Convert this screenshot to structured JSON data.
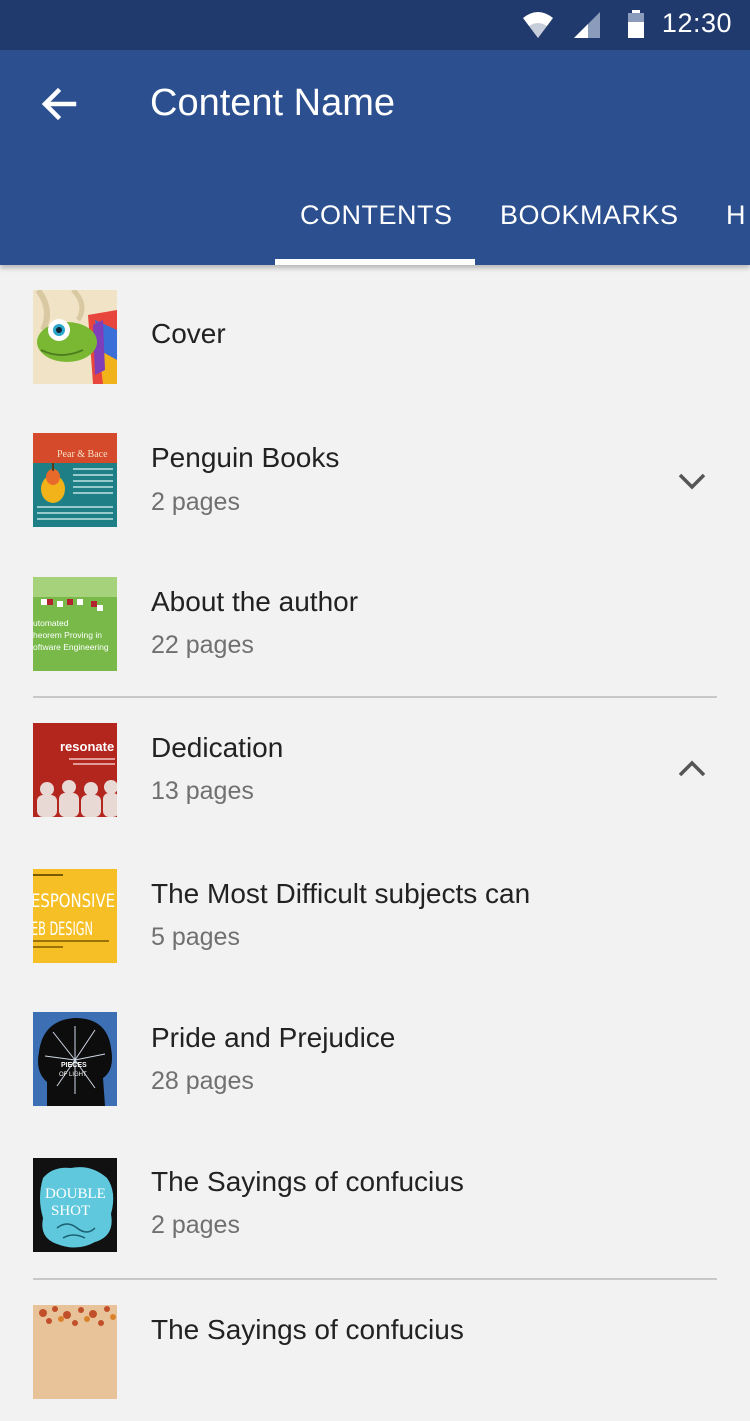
{
  "status": {
    "time": "12:30",
    "icons": [
      "wifi-icon",
      "signal-icon",
      "battery-icon"
    ]
  },
  "app_bar": {
    "title": "Content Name",
    "back_icon": "arrow-left-icon"
  },
  "tabs": [
    {
      "label": "CONTENTS",
      "selected": true
    },
    {
      "label": "BOOKMARKS",
      "selected": false
    },
    {
      "label": "H",
      "selected": false
    }
  ],
  "items": [
    {
      "title": "Cover",
      "subtitle": "",
      "cover": "chameleon-cover"
    },
    {
      "title": "Penguin Books",
      "subtitle": "2 pages",
      "expand": "collapsed",
      "cover": "pear-book-cover",
      "cover_text": "Pear & Bace"
    },
    {
      "title": "About the author",
      "subtitle": "22 pages",
      "cover": "green-book-cover",
      "cover_text": [
        "utomated",
        "heorem Proving in",
        "oftware Engineering"
      ]
    },
    {
      "title": "Dedication",
      "subtitle": "13 pages",
      "expand": "expanded",
      "cover": "resonate-cover",
      "cover_text": "resonate"
    },
    {
      "title": "The Most Difficult subjects can",
      "subtitle": "5 pages",
      "cover": "responsive-web-design-cover",
      "cover_text": [
        "ESPONSIVE",
        "EB DESIGN"
      ]
    },
    {
      "title": "Pride and Prejudice",
      "subtitle": "28 pages",
      "cover": "pieces-of-light-cover",
      "cover_text": [
        "PIECES",
        "OF LIGHT"
      ]
    },
    {
      "title": "The Sayings of confucius",
      "subtitle": "2 pages",
      "cover": "double-shot-cover",
      "cover_text": [
        "DOUBLE",
        "SHOT"
      ]
    },
    {
      "title": "The Sayings of confucius",
      "subtitle": "",
      "cover": "autumn-tree-cover"
    }
  ],
  "colors": {
    "status_bar": "#213a6e",
    "app_bar": "#2b4f8f",
    "background": "#f2f2f2"
  }
}
